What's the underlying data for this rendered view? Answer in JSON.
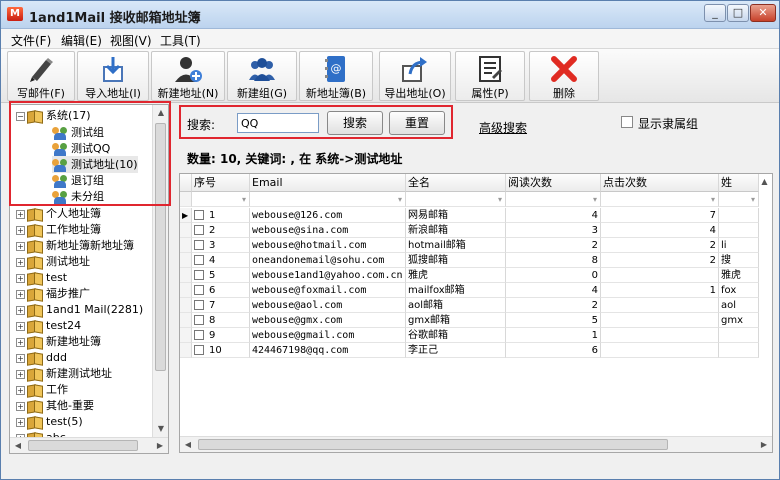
{
  "window": {
    "title": "1and1Mail 接收邮箱地址簿",
    "app_icon_glyph": "M"
  },
  "menu": [
    "文件(F)",
    "编辑(E)",
    "视图(V)",
    "工具(T)"
  ],
  "toolbar": [
    {
      "label": "写邮件(F)",
      "icon": "pencil-icon"
    },
    {
      "label": "导入地址(I)",
      "icon": "import-icon"
    },
    {
      "label": "新建地址(N)",
      "icon": "add-user-icon"
    },
    {
      "label": "新建组(G)",
      "icon": "group-icon"
    },
    {
      "label": "新地址簿(B)",
      "icon": "address-book-icon"
    },
    {
      "label": "导出地址(O)",
      "icon": "export-icon"
    },
    {
      "label": "属性(P)",
      "icon": "properties-icon"
    },
    {
      "label": "删除",
      "icon": "delete-icon"
    }
  ],
  "tree": {
    "items": [
      {
        "label": "系统(17)",
        "type": "book",
        "expander": "−"
      },
      {
        "label": "测试组",
        "type": "group"
      },
      {
        "label": "测试QQ",
        "type": "group"
      },
      {
        "label": "测试地址(10)",
        "type": "group"
      },
      {
        "label": "退订组",
        "type": "group"
      },
      {
        "label": "未分组",
        "type": "group"
      },
      {
        "label": "个人地址簿",
        "type": "book",
        "expander": "+"
      },
      {
        "label": "工作地址簿",
        "type": "book",
        "expander": "+"
      },
      {
        "label": "新地址簿新地址簿",
        "type": "book",
        "expander": "+"
      },
      {
        "label": "测试地址",
        "type": "book",
        "expander": "+"
      },
      {
        "label": "test",
        "type": "book",
        "expander": "+"
      },
      {
        "label": "福步推广",
        "type": "book",
        "expander": "+"
      },
      {
        "label": "1and1 Mail(2281)",
        "type": "book",
        "expander": "+"
      },
      {
        "label": "test24",
        "type": "book",
        "expander": "+"
      },
      {
        "label": "新建地址簿",
        "type": "book",
        "expander": "+"
      },
      {
        "label": "ddd",
        "type": "book",
        "expander": "+"
      },
      {
        "label": "新建测试地址",
        "type": "book",
        "expander": "+"
      },
      {
        "label": "工作",
        "type": "book",
        "expander": "+"
      },
      {
        "label": "其他-重要",
        "type": "book",
        "expander": "+"
      },
      {
        "label": "test(5)",
        "type": "book",
        "expander": "+"
      },
      {
        "label": "abc",
        "type": "book",
        "expander": "+"
      }
    ]
  },
  "search": {
    "label": "搜索:",
    "value": "QQ",
    "search_button": "搜索",
    "reset_button": "重置",
    "advanced_link": "高级搜索",
    "show_group_label": "显示隶属组"
  },
  "status": {
    "count_line": "数量: 10, 关键词: , 在 系统->测试地址"
  },
  "grid": {
    "columns": [
      "序号",
      "Email",
      "全名",
      "阅读次数",
      "点击次数",
      "姓"
    ],
    "rows": [
      {
        "no": "1",
        "email": "webouse@126.com",
        "name": "网易邮箱",
        "reads": "4",
        "clicks": "7",
        "surname": ""
      },
      {
        "no": "2",
        "email": "webouse@sina.com",
        "name": "新浪邮箱",
        "reads": "3",
        "clicks": "4",
        "surname": ""
      },
      {
        "no": "3",
        "email": "webouse@hotmail.com",
        "name": "hotmail邮箱",
        "reads": "2",
        "clicks": "2",
        "surname": "li"
      },
      {
        "no": "4",
        "email": "oneandonemail@sohu.com",
        "name": "狐搜邮箱",
        "reads": "8",
        "clicks": "2",
        "surname": "搜"
      },
      {
        "no": "5",
        "email": "webouse1and1@yahoo.com.cn",
        "name": "雅虎",
        "reads": "0",
        "clicks": "",
        "surname": "雅虎"
      },
      {
        "no": "6",
        "email": "webouse@foxmail.com",
        "name": "mailfox邮箱",
        "reads": "4",
        "clicks": "1",
        "surname": "fox"
      },
      {
        "no": "7",
        "email": "webouse@aol.com",
        "name": "aol邮箱",
        "reads": "2",
        "clicks": "",
        "surname": "aol"
      },
      {
        "no": "8",
        "email": "webouse@gmx.com",
        "name": "gmx邮箱",
        "reads": "5",
        "clicks": "",
        "surname": "gmx"
      },
      {
        "no": "9",
        "email": "webouse@gmail.com",
        "name": "谷歌邮箱",
        "reads": "1",
        "clicks": "",
        "surname": ""
      },
      {
        "no": "10",
        "email": "424467198@qq.com",
        "name": "李正己",
        "reads": "6",
        "clicks": "",
        "surname": ""
      }
    ]
  },
  "colors": {
    "highlight": "#e0262f",
    "delete_red": "#e02b22",
    "title_bar": "#bcd3ee"
  }
}
